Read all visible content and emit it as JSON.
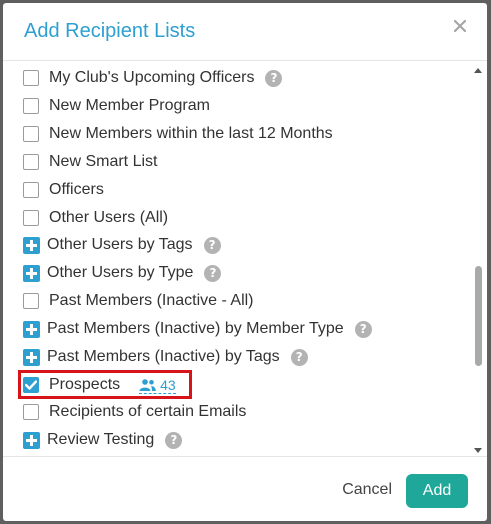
{
  "dialog": {
    "title": "Add Recipient Lists",
    "close_glyph": "×"
  },
  "list": {
    "items": [
      {
        "label": "My Club's Upcoming Officers",
        "control": "checkbox",
        "checked": false,
        "help": true
      },
      {
        "label": "New Member Program",
        "control": "checkbox",
        "checked": false,
        "help": false
      },
      {
        "label": "New Members within the last 12 Months",
        "control": "checkbox",
        "checked": false,
        "help": false
      },
      {
        "label": "New Smart List",
        "control": "checkbox",
        "checked": false,
        "help": false
      },
      {
        "label": "Officers",
        "control": "checkbox",
        "checked": false,
        "help": false
      },
      {
        "label": "Other Users (All)",
        "control": "checkbox",
        "checked": false,
        "help": false
      },
      {
        "label": "Other Users by Tags",
        "control": "expander",
        "help": true
      },
      {
        "label": "Other Users by Type",
        "control": "expander",
        "help": true
      },
      {
        "label": "Past Members (Inactive - All)",
        "control": "checkbox",
        "checked": false,
        "help": false
      },
      {
        "label": "Past Members (Inactive) by Member Type",
        "control": "expander",
        "help": true
      },
      {
        "label": "Past Members (Inactive) by Tags",
        "control": "expander",
        "help": true
      },
      {
        "label": "Prospects",
        "control": "checkbox",
        "checked": true,
        "help": false,
        "count": "43"
      },
      {
        "label": "Recipients of certain Emails",
        "control": "checkbox",
        "checked": false,
        "help": false
      },
      {
        "label": "Review Testing",
        "control": "expander",
        "help": true
      }
    ],
    "help_glyph": "?"
  },
  "footer": {
    "cancel_label": "Cancel",
    "add_label": "Add"
  },
  "colors": {
    "accent": "#2d9fd0",
    "primary_button": "#1fa899",
    "highlight": "#d8141b"
  }
}
